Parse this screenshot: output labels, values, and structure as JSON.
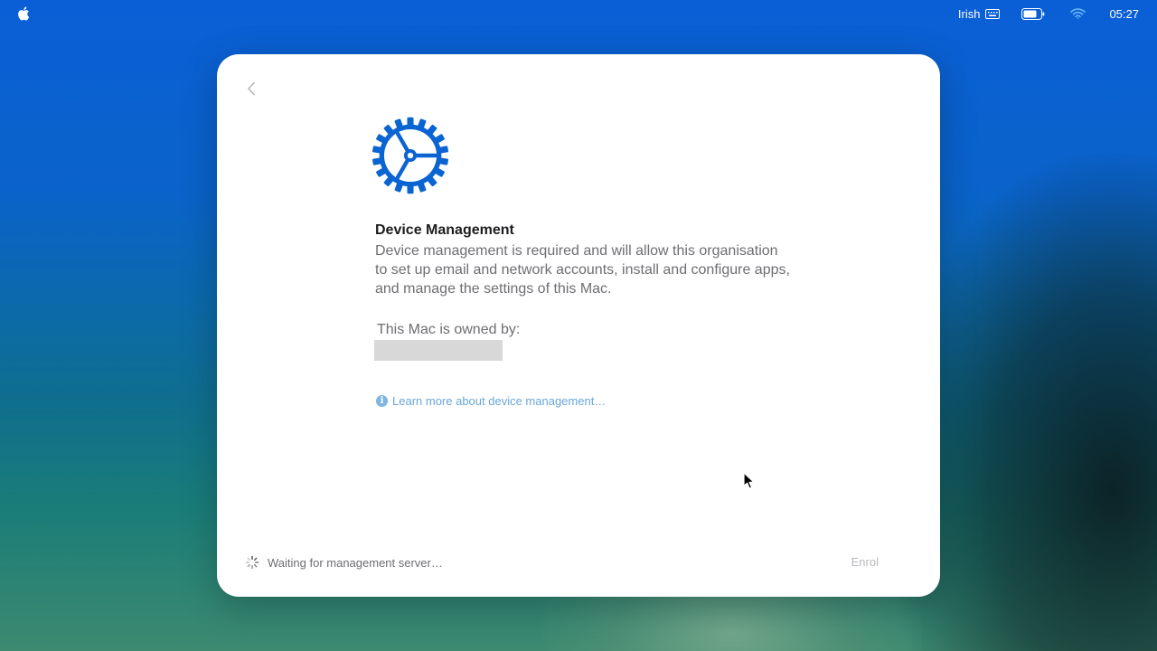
{
  "menubar": {
    "apple_icon": "apple-logo-icon",
    "input_language": "Irish",
    "keyboard_icon": "keyboard-icon",
    "battery_icon": "battery-icon",
    "wifi_icon": "wifi-icon",
    "clock": "05:27"
  },
  "sheet": {
    "back_icon": "chevron-left-icon",
    "header_icon": "gear-icon",
    "title": "Device Management",
    "description": "Device management is required and will allow this organisation to set up email and network accounts, install and configure apps, and manage the settings of this Mac.",
    "owned_by_label": "This Mac is owned by:",
    "learn_more": "Learn more about device management…",
    "status_text": "Waiting for management server…",
    "enrol_label": "Enrol"
  },
  "colors": {
    "accent": "#0a64d2",
    "link": "#6aa7d8",
    "disabled": "#b9b9bd"
  }
}
